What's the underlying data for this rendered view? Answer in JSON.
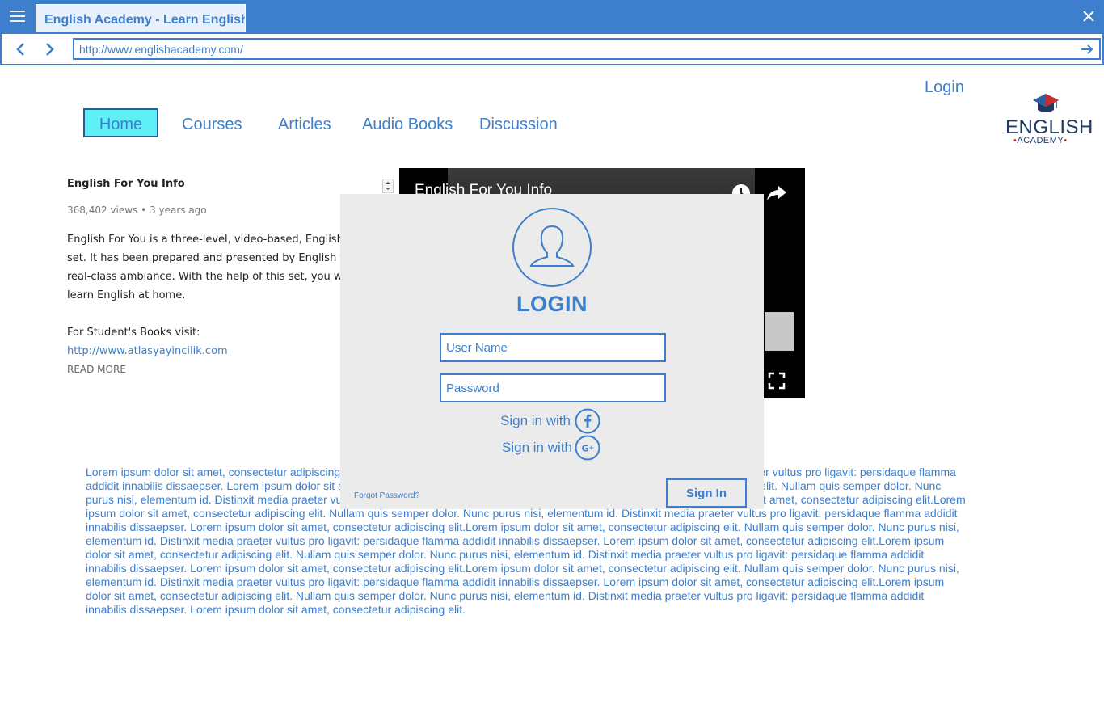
{
  "browser": {
    "tab_title": "English Academy - Learn English",
    "url": "http://www.englishacademy.com/",
    "accent_color": "#3d7fcc"
  },
  "header": {
    "login_label": "Login",
    "nav": [
      {
        "label": "Home",
        "active": true
      },
      {
        "label": "Courses"
      },
      {
        "label": "Articles"
      },
      {
        "label": "Audio Books"
      },
      {
        "label": "Discussion"
      }
    ],
    "logo": {
      "word": "ENGLISH",
      "sub": "ACADEMY"
    }
  },
  "video_info": {
    "title": "English For You Info",
    "meta": "368,402 views • 3 years ago",
    "description_lines": [
      "English For You is a three-level, video-based, English le",
      "set. It has been prepared and presented by English tea",
      "real-class ambiance. With the help of this set, you will l",
      "learn English at home."
    ],
    "books_label": "For Student's Books visit:",
    "books_url": "http://www.atlasyayincilik.com",
    "read_more": "READ MORE"
  },
  "video": {
    "title": "English For You Info",
    "icons": [
      "clock-icon",
      "share-icon",
      "fullscreen-icon"
    ]
  },
  "body_text": "Lorem ipsum dolor sit amet, consectetur adipiscing elit. Nullam quis semper dolor. Nunc purus nisi, elementum id. Distinxit media praeter vultus pro ligavit: persidaque flamma addidit innabilis dissaepser. Lorem ipsum dolor sit amet, consectetur adipiscing elit.Lorem ipsum dolor sit amet, consectetur adipiscing elit. Nullam quis semper dolor. Nunc purus nisi, elementum id. Distinxit media praeter vultus pro ligavit: persidaque flamma addidit innabilis dissaepser. Lorem ipsum dolor sit amet, consectetur adipiscing elit.Lorem ipsum dolor sit amet, consectetur adipiscing elit. Nullam quis semper dolor. Nunc purus nisi, elementum id. Distinxit media praeter vultus pro ligavit: persidaque flamma addidit innabilis dissaepser. Lorem ipsum dolor sit amet, consectetur adipiscing elit.Lorem ipsum dolor sit amet, consectetur adipiscing elit. Nullam quis semper dolor. Nunc purus nisi, elementum id. Distinxit media praeter vultus pro ligavit: persidaque flamma addidit innabilis dissaepser. Lorem ipsum dolor sit amet, consectetur adipiscing elit.Lorem ipsum dolor sit amet, consectetur adipiscing elit. Nullam quis semper dolor. Nunc purus nisi, elementum id. Distinxit media praeter vultus pro ligavit: persidaque flamma addidit innabilis dissaepser. Lorem ipsum dolor sit amet, consectetur adipiscing elit.Lorem ipsum dolor sit amet, consectetur adipiscing elit. Nullam quis semper dolor. Nunc purus nisi, elementum id. Distinxit media praeter vultus pro ligavit: persidaque flamma addidit innabilis dissaepser. Lorem ipsum dolor sit amet, consectetur adipiscing elit.Lorem ipsum dolor sit amet, consectetur adipiscing elit. Nullam quis semper dolor. Nunc purus nisi, elementum id. Distinxit media praeter vultus pro ligavit: persidaque flamma addidit innabilis dissaepser. Lorem ipsum dolor sit amet, consectetur adipiscing elit.",
  "login_modal": {
    "title": "LOGIN",
    "username_placeholder": "User Name",
    "password_placeholder": "Password",
    "facebook_label": "Sign in with",
    "google_label": "Sign in with",
    "forgot_label": "Forgot Password?",
    "signin_label": "Sign In"
  }
}
